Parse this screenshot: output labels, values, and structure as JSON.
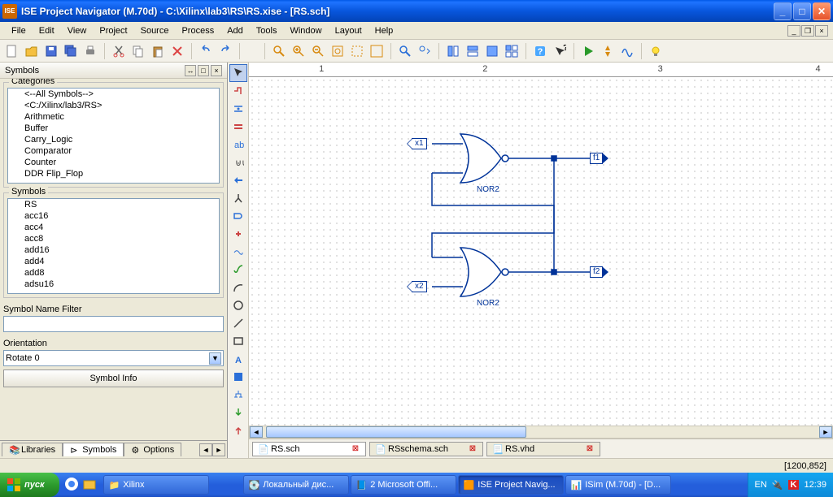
{
  "titlebar": {
    "text": "ISE Project Navigator (M.70d) - C:\\Xilinx\\lab3\\RS\\RS.xise - [RS.sch]"
  },
  "menu": [
    "File",
    "Edit",
    "View",
    "Project",
    "Source",
    "Process",
    "Add",
    "Tools",
    "Window",
    "Layout",
    "Help"
  ],
  "side": {
    "panel_title": "Symbols",
    "categories_label": "Categories",
    "categories": [
      "<--All Symbols-->",
      "<C:/Xilinx/lab3/RS>",
      "Arithmetic",
      "Buffer",
      "Carry_Logic",
      "Comparator",
      "Counter",
      "DDR Flip_Flop"
    ],
    "symbols_label": "Symbols",
    "symbols": [
      "RS",
      "acc16",
      "acc4",
      "acc8",
      "add16",
      "add4",
      "add8",
      "adsu16"
    ],
    "filter_label": "Symbol Name Filter",
    "filter_value": "",
    "orient_label": "Orientation",
    "orient_value": "Rotate 0",
    "info_btn": "Symbol Info",
    "tabs": [
      "Libraries",
      "Symbols",
      "Options"
    ],
    "active_tab": 1
  },
  "ruler_ticks": [
    "1",
    "2",
    "3",
    "4"
  ],
  "schematic": {
    "x1": "x1",
    "x2": "x2",
    "f1": "f1",
    "f2": "f2",
    "g1": "NOR2",
    "g2": "NOR2"
  },
  "doc_tabs": [
    {
      "name": "RS.sch",
      "active": true
    },
    {
      "name": "RSschema.sch",
      "active": false
    },
    {
      "name": "RS.vhd",
      "active": false
    }
  ],
  "status": "[1200,852]",
  "taskbar": {
    "start": "пуск",
    "items": [
      {
        "label": "Xilinx",
        "active": false
      },
      {
        "label": "Локальный дис...",
        "active": false
      },
      {
        "label": "2 Microsoft Offi...",
        "active": false
      },
      {
        "label": "ISE Project Navig...",
        "active": true
      },
      {
        "label": "ISim (M.70d) - [D...",
        "active": false
      }
    ],
    "lang": "EN",
    "time": "12:39"
  }
}
